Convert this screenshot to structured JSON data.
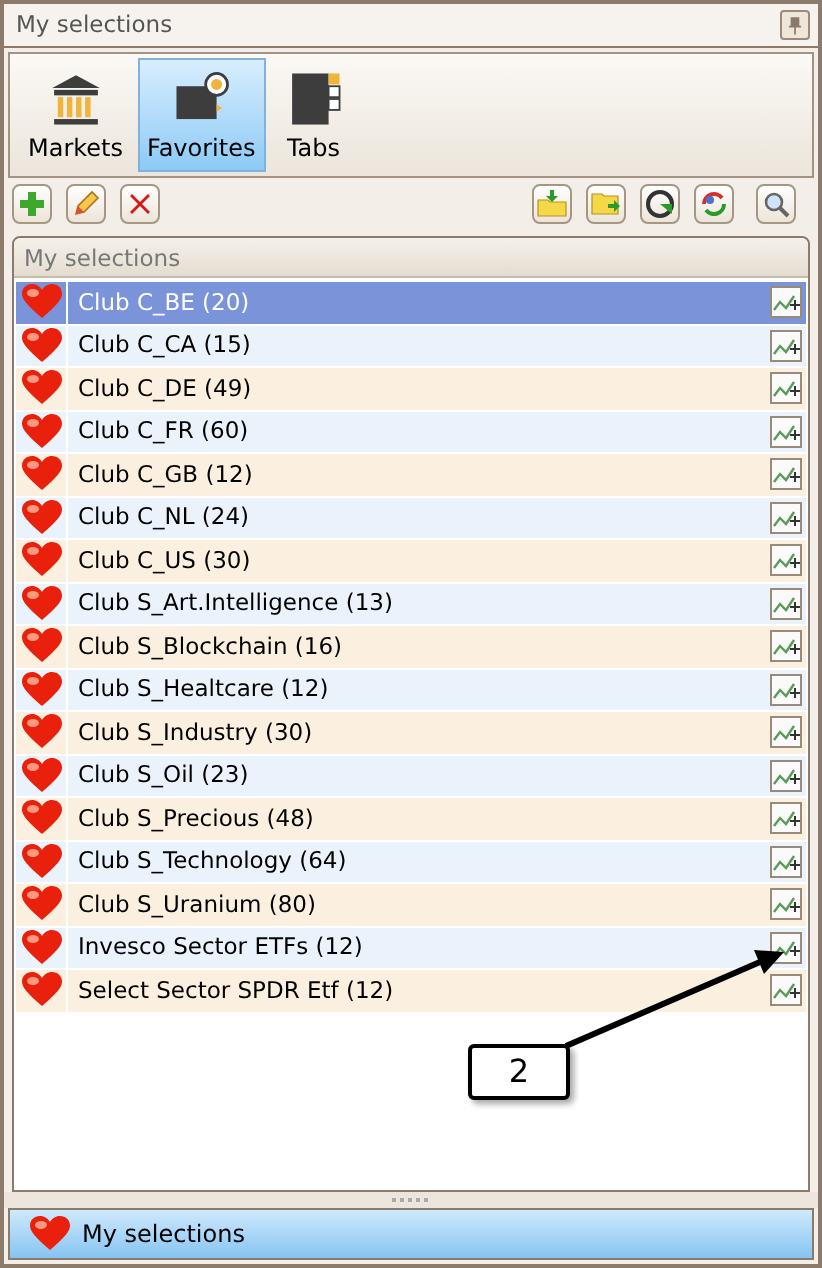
{
  "panel": {
    "title": "My selections"
  },
  "tabs": [
    {
      "label": "Markets",
      "kind": "markets",
      "selected": false
    },
    {
      "label": "Favorites",
      "kind": "favorites",
      "selected": true
    },
    {
      "label": "Tabs",
      "kind": "tabs",
      "selected": false
    }
  ],
  "toolbar": {
    "left": [
      {
        "kind": "add"
      },
      {
        "kind": "edit"
      },
      {
        "kind": "delete"
      }
    ],
    "right": [
      {
        "kind": "import"
      },
      {
        "kind": "export"
      },
      {
        "kind": "refresh"
      },
      {
        "kind": "sync"
      },
      {
        "kind": "search"
      }
    ]
  },
  "list": {
    "header": "My selections",
    "rows": [
      {
        "label": "Club C_BE (20)",
        "selected": true
      },
      {
        "label": "Club C_CA (15)",
        "selected": false
      },
      {
        "label": "Club C_DE (49)",
        "selected": false
      },
      {
        "label": "Club C_FR (60)",
        "selected": false
      },
      {
        "label": "Club C_GB (12)",
        "selected": false
      },
      {
        "label": "Club C_NL (24)",
        "selected": false
      },
      {
        "label": "Club C_US (30)",
        "selected": false
      },
      {
        "label": "Club S_Art.Intelligence (13)",
        "selected": false
      },
      {
        "label": "Club S_Blockchain (16)",
        "selected": false
      },
      {
        "label": "Club S_Healtcare (12)",
        "selected": false
      },
      {
        "label": "Club S_Industry (30)",
        "selected": false
      },
      {
        "label": "Club S_Oil (23)",
        "selected": false
      },
      {
        "label": "Club S_Precious (48)",
        "selected": false
      },
      {
        "label": "Club S_Technology (64)",
        "selected": false
      },
      {
        "label": "Club S_Uranium (80)",
        "selected": false
      },
      {
        "label": "Invesco Sector ETFs (12)",
        "selected": false
      },
      {
        "label": "Select Sector SPDR Etf (12)",
        "selected": false
      }
    ]
  },
  "callout": {
    "label": "2"
  },
  "footer": {
    "label": "My selections"
  }
}
